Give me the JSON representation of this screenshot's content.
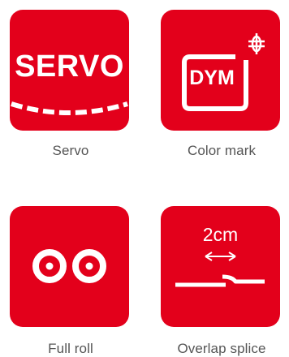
{
  "tiles": [
    {
      "icon": "servo-icon",
      "icon_text": "SERVO",
      "caption": "Servo"
    },
    {
      "icon": "color-mark-icon",
      "icon_text": "DYM",
      "caption": "Color mark"
    },
    {
      "icon": "full-roll-icon",
      "caption": "Full roll"
    },
    {
      "icon": "overlap-splice-icon",
      "icon_text": "2cm",
      "caption": "Overlap splice"
    }
  ],
  "colors": {
    "tile": "#e3001b",
    "icon": "#ffffff",
    "caption": "#555555"
  }
}
